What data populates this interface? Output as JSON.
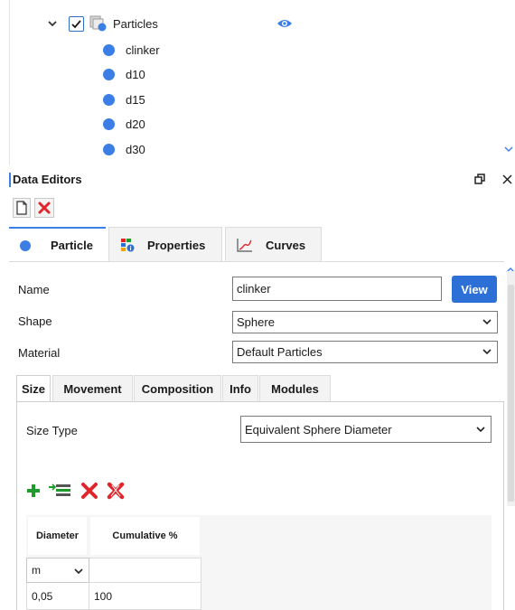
{
  "tree": {
    "group": {
      "label": "Particles",
      "checked": true,
      "expanded": true,
      "visible": true
    },
    "items": [
      {
        "label": "clinker",
        "color": "#3b7ee6"
      },
      {
        "label": "d10",
        "color": "#3b7ee6"
      },
      {
        "label": "d15",
        "color": "#3b7ee6"
      },
      {
        "label": "d20",
        "color": "#3b7ee6"
      },
      {
        "label": "d30",
        "color": "#3b7ee6"
      }
    ]
  },
  "data_editors": {
    "title": "Data Editors",
    "tabs": [
      {
        "label": "Particle",
        "icon": "blue-dot-icon",
        "active": true
      },
      {
        "label": "Properties",
        "icon": "properties-grid-icon",
        "active": false
      },
      {
        "label": "Curves",
        "icon": "chart-curve-icon",
        "active": false
      }
    ],
    "fields": {
      "name_label": "Name",
      "name_value": "clinker",
      "view_button": "View",
      "shape_label": "Shape",
      "shape_value": "Sphere",
      "material_label": "Material",
      "material_value": "Default Particles"
    },
    "sub_tabs": [
      {
        "label": "Size",
        "active": true
      },
      {
        "label": "Movement",
        "active": false
      },
      {
        "label": "Composition",
        "active": false
      },
      {
        "label": "Info",
        "active": false
      },
      {
        "label": "Modules",
        "active": false
      }
    ],
    "size": {
      "type_label": "Size Type",
      "type_value": "Equivalent Sphere Diameter",
      "table": {
        "columns": [
          "Diameter",
          "Cumulative %"
        ],
        "unit": "m",
        "rows": [
          [
            "0,05",
            "100"
          ]
        ]
      }
    }
  },
  "colors": {
    "accent": "#3b7ee6",
    "button": "#2c6fd6",
    "add_green": "#1f9a2c",
    "delete_red": "#e0262b"
  }
}
